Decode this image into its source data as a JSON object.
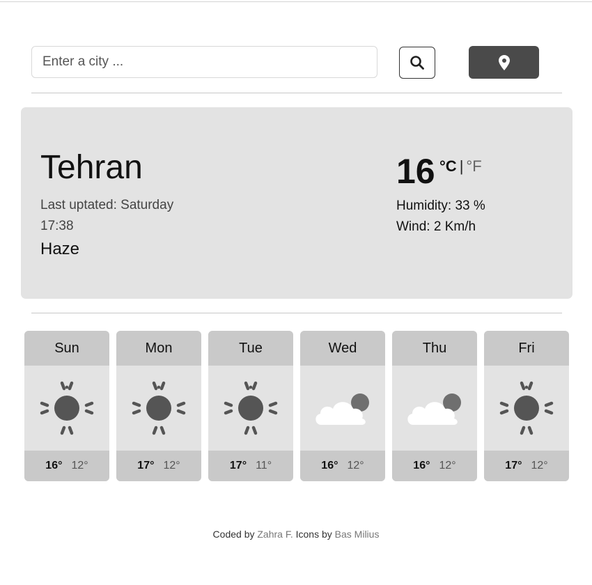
{
  "search": {
    "placeholder": "Enter a city ...",
    "value": ""
  },
  "icons": {
    "search": "search-icon",
    "location": "map-pin-icon"
  },
  "current": {
    "city": "Tehran",
    "last_updated": "Last uptated: Saturday 17:38",
    "condition": "Haze",
    "condition_icon": "haze-icon",
    "temperature": "16",
    "unit_c": "°C",
    "unit_separator": "|",
    "unit_f": "°F",
    "humidity": "Humidity: 33 %",
    "wind": "Wind: 2 Km/h"
  },
  "forecast": [
    {
      "day": "Sun",
      "icon": "sun-icon",
      "max": "16°",
      "min": "12°"
    },
    {
      "day": "Mon",
      "icon": "sun-icon",
      "max": "17°",
      "min": "12°"
    },
    {
      "day": "Tue",
      "icon": "sun-icon",
      "max": "17°",
      "min": "11°"
    },
    {
      "day": "Wed",
      "icon": "cloud-icon",
      "max": "16°",
      "min": "12°"
    },
    {
      "day": "Thu",
      "icon": "cloud-icon",
      "max": "16°",
      "min": "12°"
    },
    {
      "day": "Fri",
      "icon": "sun-icon",
      "max": "17°",
      "min": "12°"
    }
  ],
  "footer": {
    "coded_by": "Coded by",
    "author": "Zahra F.",
    "icons_by": "Icons by",
    "icon_author": "Bas Milius"
  },
  "colors": {
    "panel": "#e3e3e3",
    "panel_header": "#c9c9c9",
    "location_button": "#4a4a4a"
  }
}
